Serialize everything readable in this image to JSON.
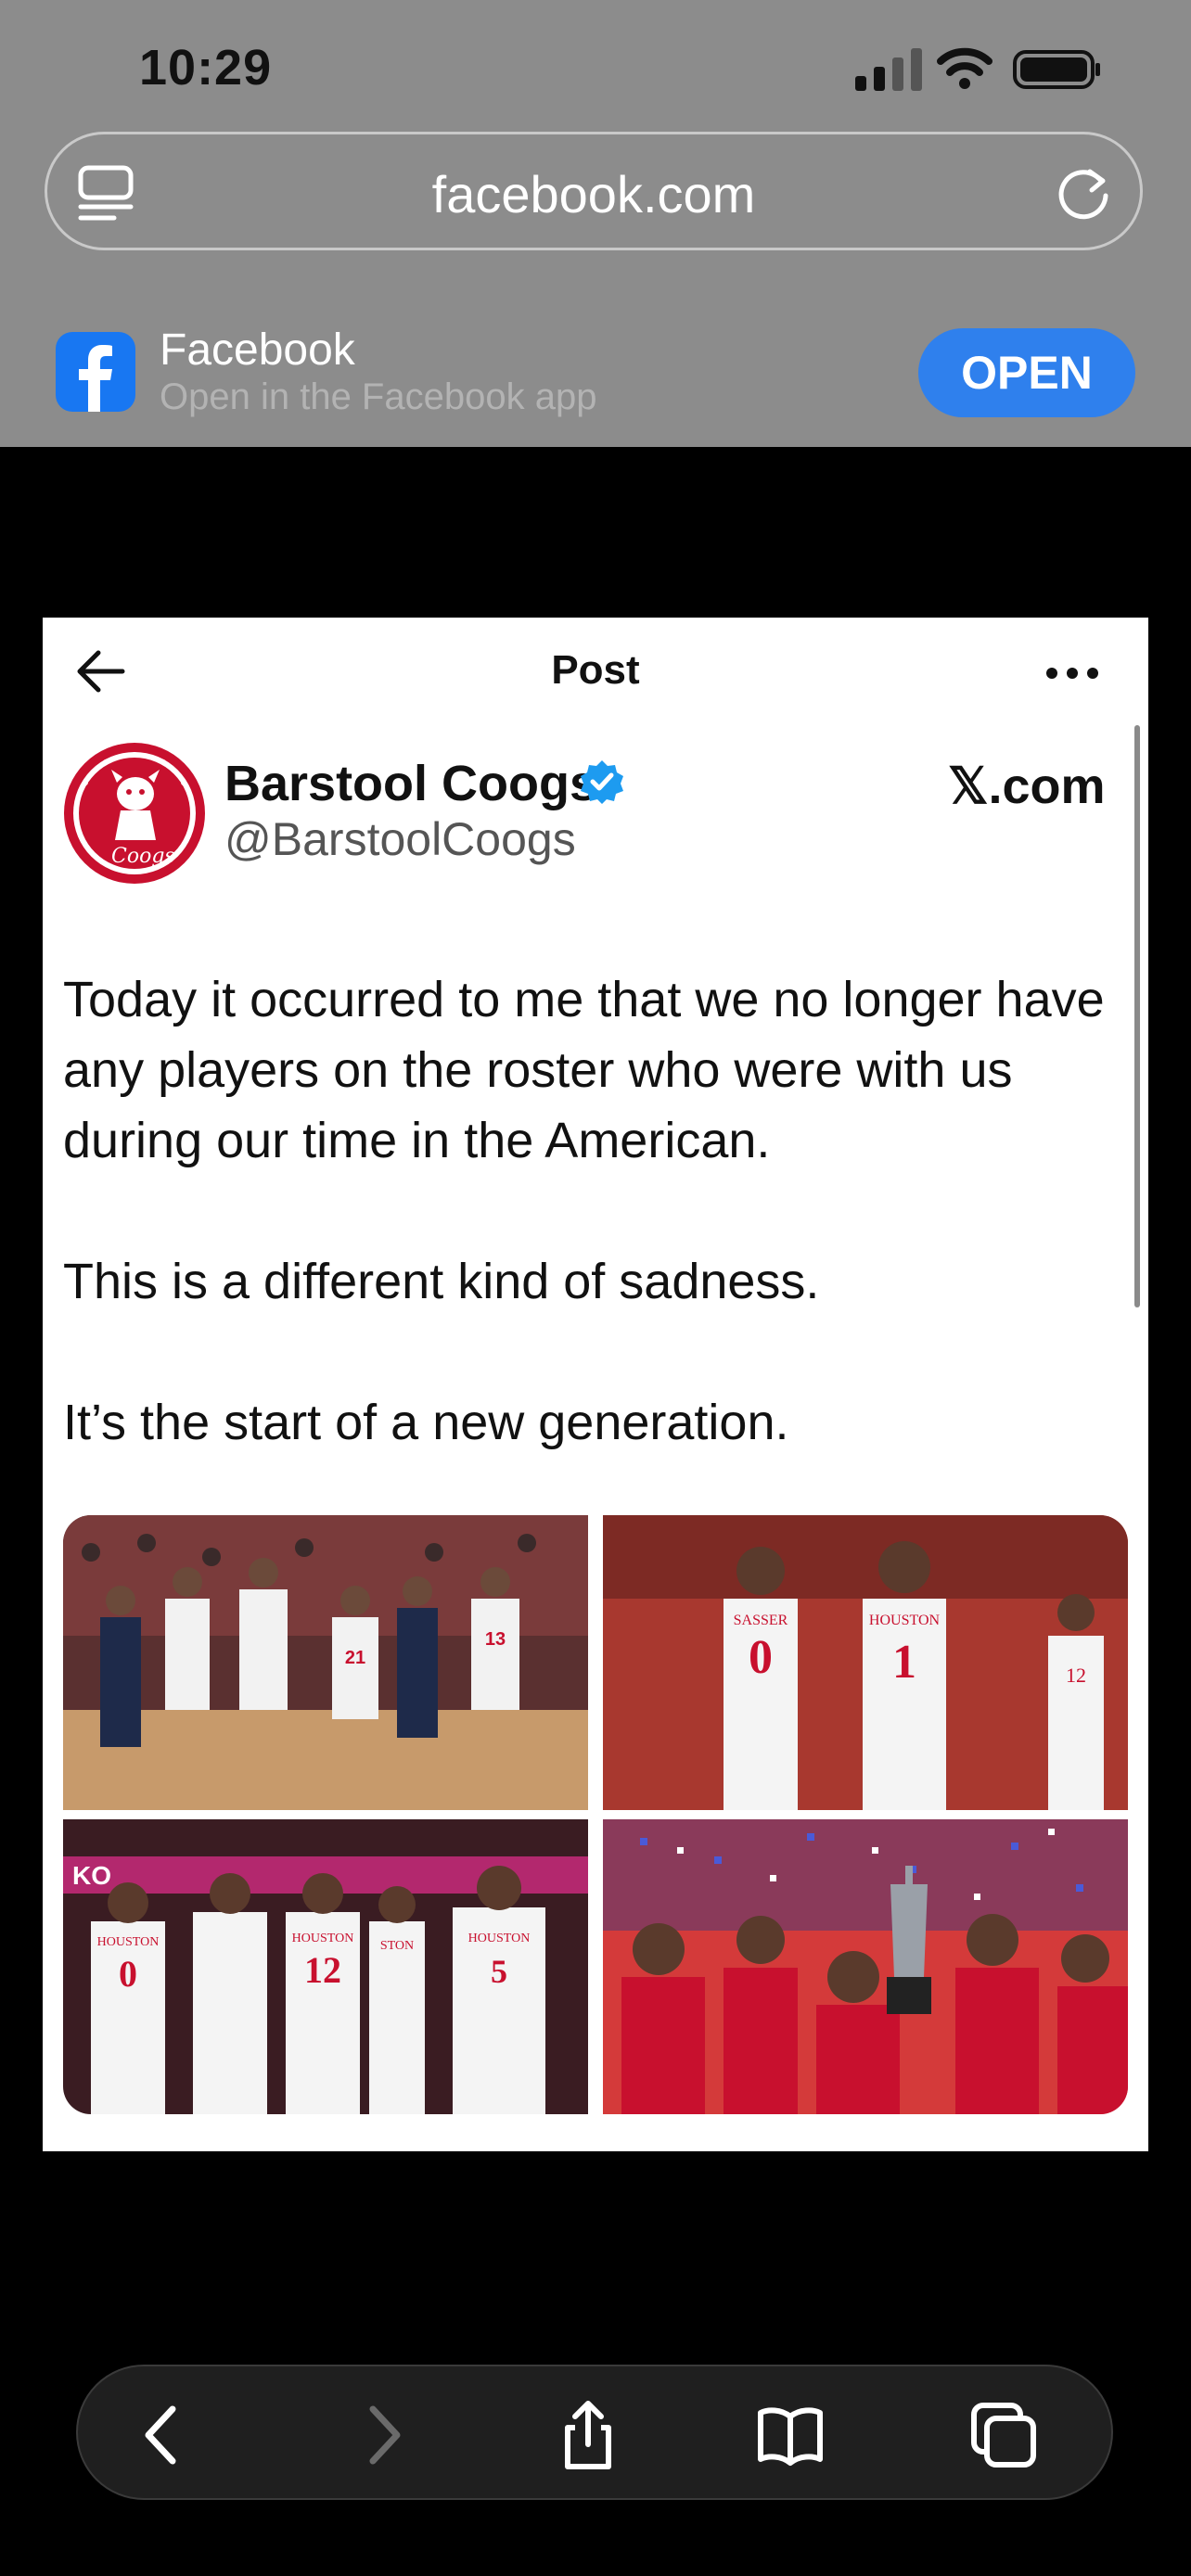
{
  "status_bar": {
    "time": "10:29"
  },
  "browser": {
    "url": "facebook.com"
  },
  "app_banner": {
    "title": "Facebook",
    "subtitle": "Open in the Facebook app",
    "open_label": "OPEN"
  },
  "post": {
    "header_title": "Post",
    "author_name": "Barstool Coogs",
    "author_handle": "@BarstoolCoogs",
    "source_brand": "𝕏.com",
    "body_lines": [
      "Today it occurred to me that we no longer have any players on the roster who were with us during our time in the American.",
      "This is a different kind of sadness.",
      "It’s the start of a new generation."
    ],
    "avatar_text": "Coogs",
    "photos": [
      {
        "jerseys": [
          "21",
          "13"
        ]
      },
      {
        "jerseys": [
          "SASSER",
          "0",
          "HOUSTON",
          "1",
          "12"
        ]
      },
      {
        "jerseys": [
          "HOUSTON",
          "0",
          "HOUSTON",
          "12",
          "STON",
          "HOUSTON",
          "5"
        ]
      },
      {
        "jerseys": []
      }
    ]
  },
  "colors": {
    "facebook_blue": "#1877f2",
    "open_button": "#2f80ed",
    "verified_blue": "#1d9bf0",
    "houston_red": "#c8102e"
  }
}
